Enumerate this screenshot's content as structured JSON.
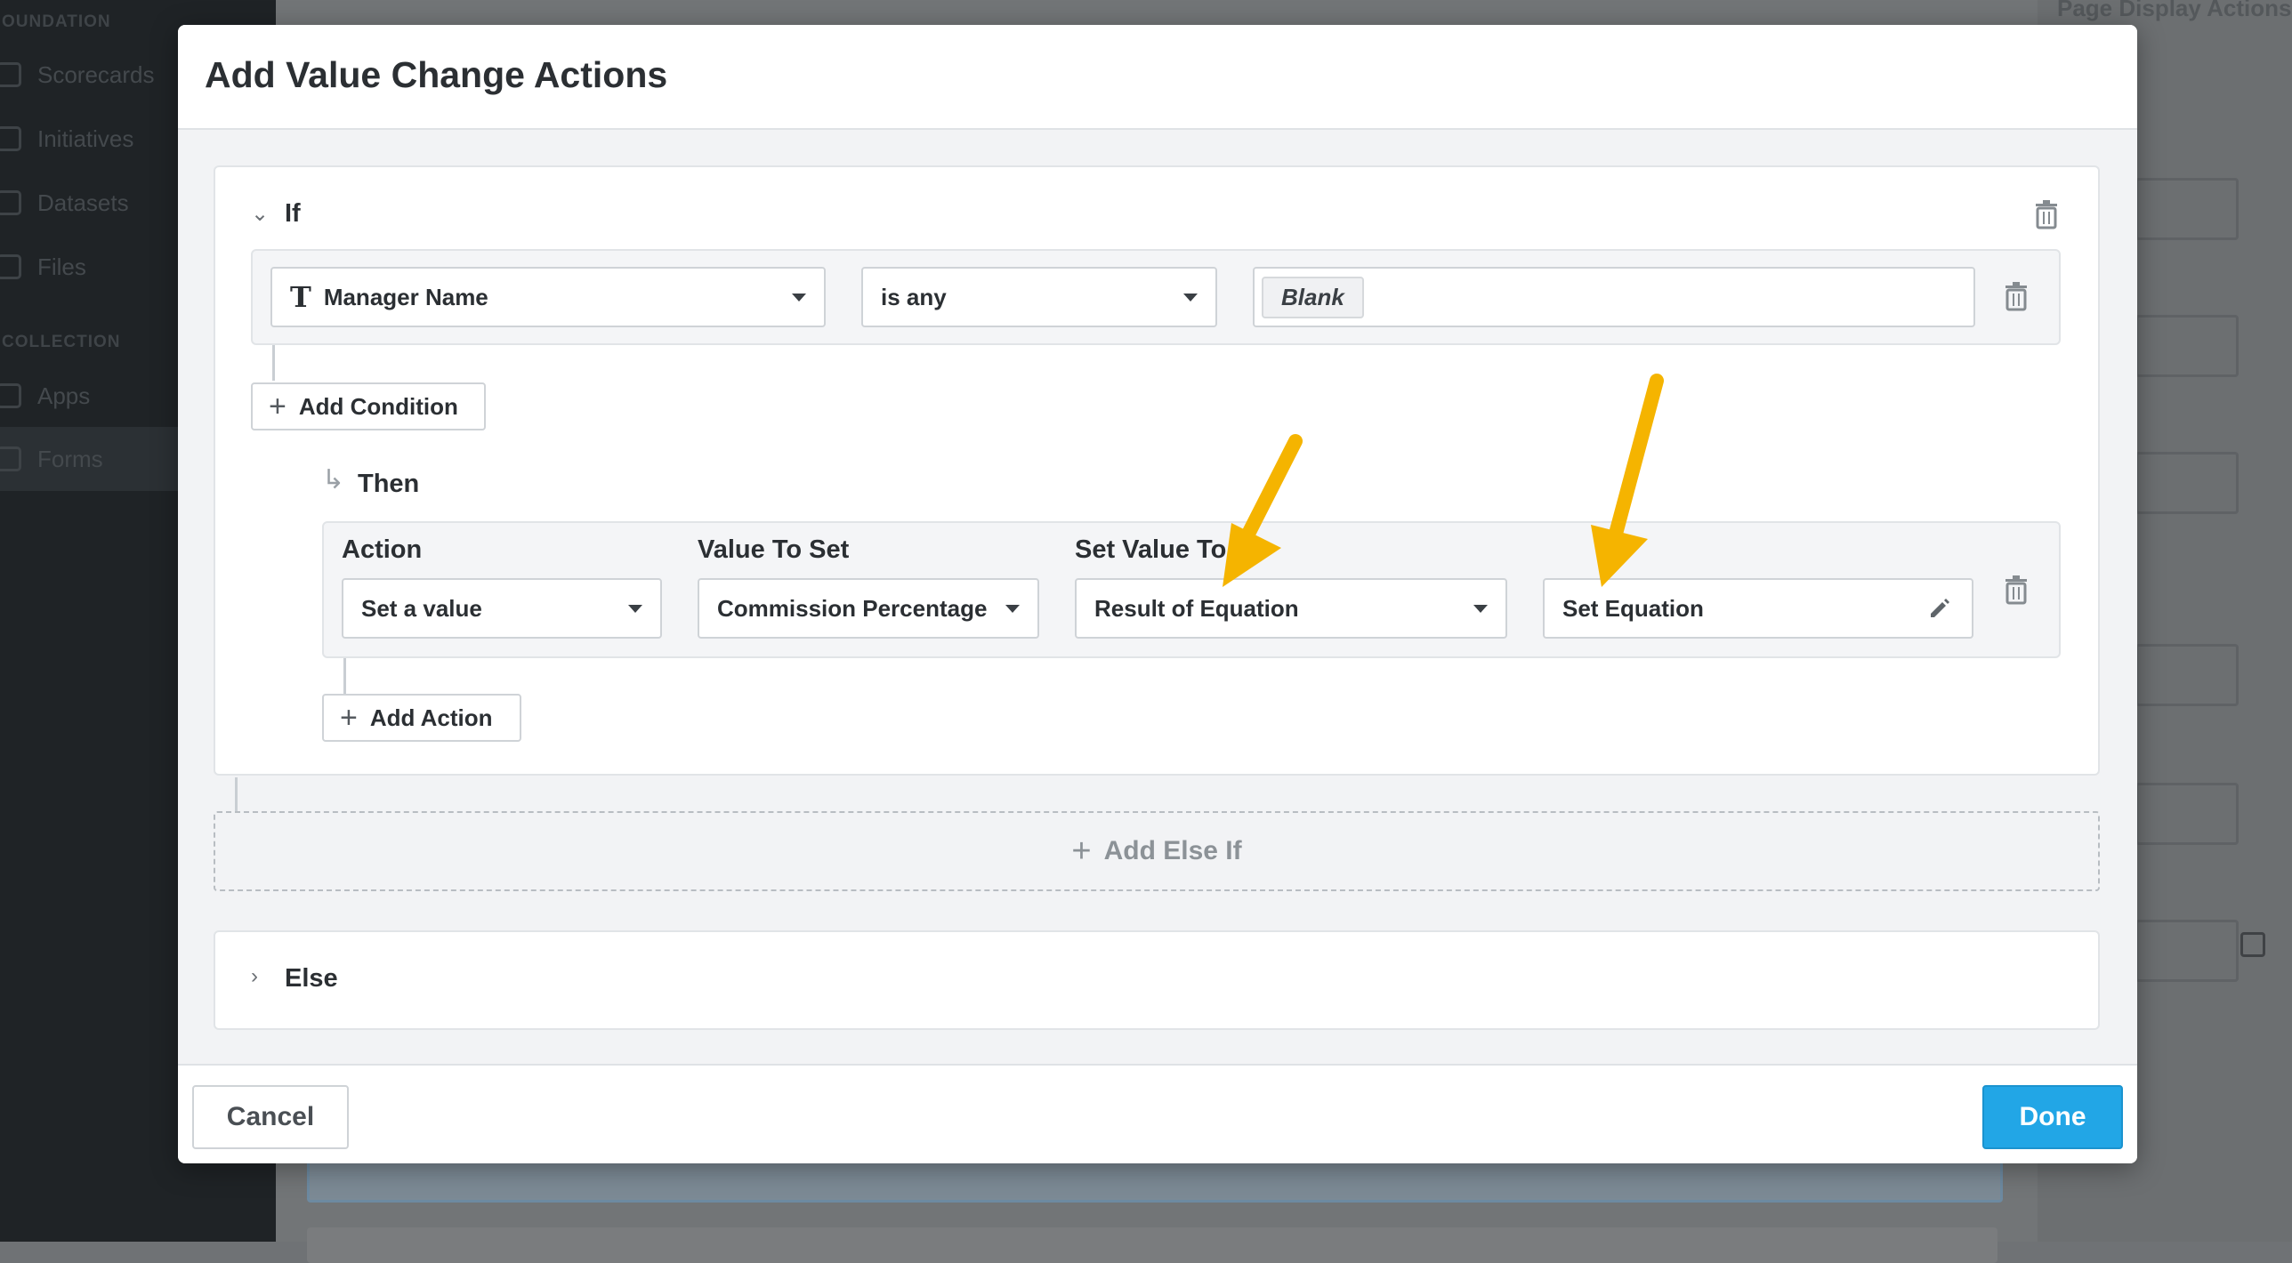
{
  "background": {
    "sidebar": {
      "section_foundation": "OUNDATION",
      "section_collection": "COLLECTION",
      "items": [
        {
          "label": "Scorecards"
        },
        {
          "label": "Initiatives"
        },
        {
          "label": "Datasets"
        },
        {
          "label": "Files"
        },
        {
          "label": "Apps"
        },
        {
          "label": "Forms"
        }
      ],
      "active_item": "Forms"
    },
    "right_panel": {
      "title": "Page Display Actions"
    }
  },
  "modal": {
    "title": "Add Value Change Actions",
    "if_block": {
      "label": "If",
      "condition": {
        "field_type_icon": "text-type-icon",
        "field": "Manager Name",
        "operator": "is any",
        "value_tag": "Blank"
      },
      "add_condition_label": "Add Condition",
      "then_label": "Then",
      "action": {
        "action_label": "Action",
        "action_value": "Set a value",
        "value_to_set_label": "Value To Set",
        "value_to_set_value": "Commission Percentage",
        "set_value_to_label": "Set Value To",
        "set_value_to_value": "Result of Equation",
        "equation_label": "Set Equation"
      },
      "add_action_label": "Add Action"
    },
    "add_else_if_label": "Add Else If",
    "else_label": "Else",
    "footer": {
      "cancel_label": "Cancel",
      "done_label": "Done"
    }
  },
  "colors": {
    "primary_button": "#22a6e6",
    "annotation_arrow": "#f5b400"
  }
}
